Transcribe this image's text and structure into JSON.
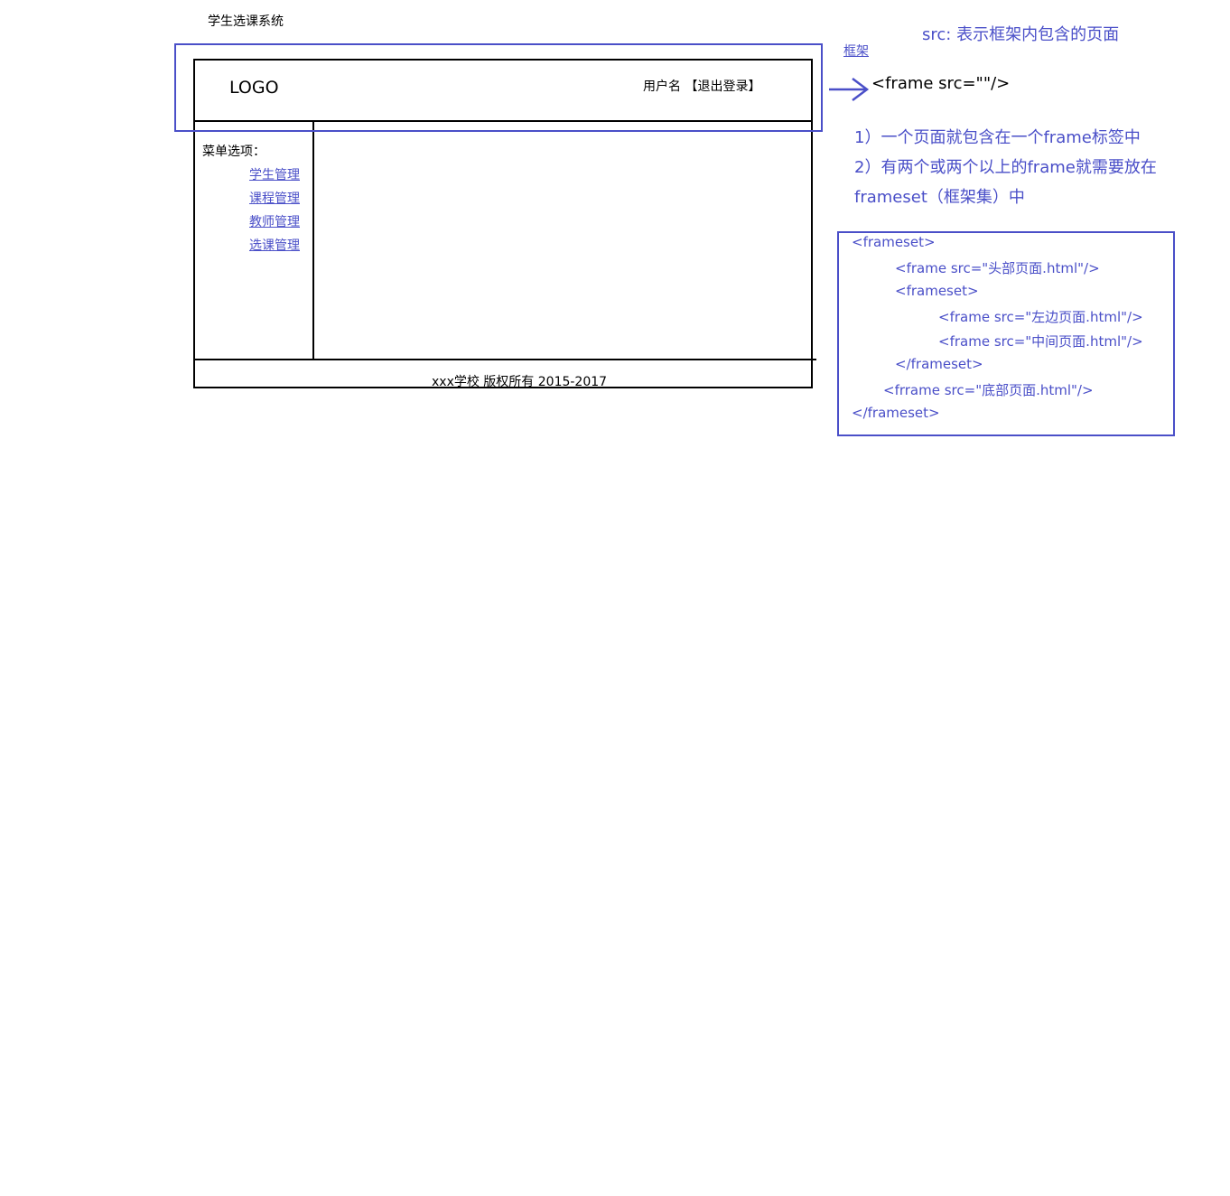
{
  "page_title": "学生选课系统",
  "wireframe": {
    "logo": "LOGO",
    "user_info": "用户名 【退出登录】",
    "menu_title": "菜单选项：",
    "menu_items": [
      "学生管理",
      "课程管理",
      "教师管理",
      "选课管理"
    ],
    "footer": "xxx学校 版权所有 2015-2017"
  },
  "annotations": {
    "frame_label": "框架",
    "src_note": "src: 表示框架内包含的页面",
    "frame_tag": "<frame  src=\"\"/>",
    "rules": [
      "1）一个页面就包含在一个frame标签中",
      "2）有两个或两个以上的frame就需要放在",
      "frameset（框架集）中"
    ],
    "code": [
      "<frameset>",
      "<frame src=\"头部页面.html\"/>",
      "<frameset>",
      "<frame src=\"左边页面.html\"/>",
      "<frame src=\"中间页面.html\"/>",
      "</frameset>",
      "<frrame src=\"底部页面.html\"/>",
      "</frameset>"
    ]
  },
  "colors": {
    "annotation": "#4a4fc8",
    "wireframe_line": "#000000"
  }
}
